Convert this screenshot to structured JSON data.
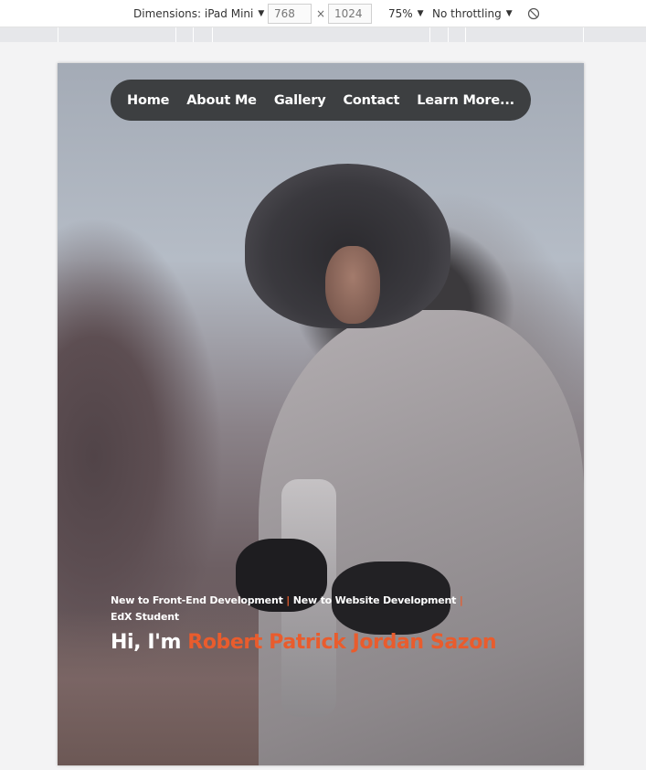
{
  "devtools": {
    "dimensions_label": "Dimensions: iPad Mini",
    "width": "768",
    "times": "×",
    "height": "1024",
    "zoom": "75%",
    "throttling": "No throttling",
    "caret_icon": "▼",
    "rotate_icon": "⦸"
  },
  "nav": {
    "items": [
      "Home",
      "About Me",
      "Gallery",
      "Contact",
      "Learn More..."
    ]
  },
  "hero": {
    "role_1": "New to Front-End Development",
    "role_2": "New to Website Development",
    "role_3": "EdX Student",
    "separator": "|",
    "greeting_prefix": "Hi, I'm ",
    "name": "Robert Patrick Jordan Sazon"
  },
  "colors": {
    "accent": "#e95c2d",
    "nav_bg": "#3d3f41"
  }
}
